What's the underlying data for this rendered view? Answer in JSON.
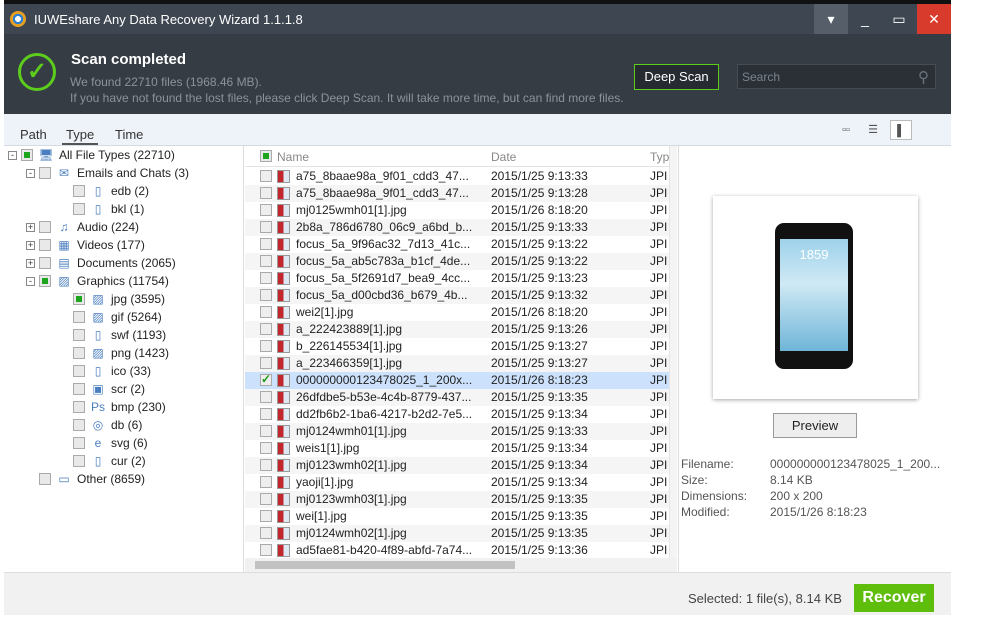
{
  "window": {
    "title": "IUWEshare Any Data Recovery Wizard 1.1.1.8",
    "close_color": "#d83b2b"
  },
  "header": {
    "title": "Scan completed",
    "found": "We found 22710 files (1968.46 MB).",
    "hint": "If you have not found the lost files, please click Deep Scan. It will take more time, but can find more files.",
    "deep_scan": "Deep Scan",
    "search_placeholder": "Search"
  },
  "tabs": [
    {
      "label": "Path"
    },
    {
      "label": "Type",
      "active": true
    },
    {
      "label": "Time"
    }
  ],
  "tree": [
    {
      "label": "All File Types (22710)",
      "level": 0,
      "toggle": "-",
      "checked": true,
      "icon": "monitor-icon"
    },
    {
      "label": "Emails and Chats (3)",
      "level": 1,
      "toggle": "-",
      "icon": "email-icon"
    },
    {
      "label": "edb (2)",
      "level": 2,
      "icon": "file-icon"
    },
    {
      "label": "bkl (1)",
      "level": 2,
      "icon": "file-icon"
    },
    {
      "label": "Audio (224)",
      "level": 1,
      "toggle": "+",
      "icon": "music-icon"
    },
    {
      "label": "Videos (177)",
      "level": 1,
      "toggle": "+",
      "icon": "film-icon"
    },
    {
      "label": "Documents (2065)",
      "level": 1,
      "toggle": "+",
      "icon": "document-icon"
    },
    {
      "label": "Graphics (11754)",
      "level": 1,
      "toggle": "-",
      "checked": true,
      "icon": "picture-icon"
    },
    {
      "label": "jpg (3595)",
      "level": 2,
      "checked": true,
      "icon": "image-icon"
    },
    {
      "label": "gif (5264)",
      "level": 2,
      "icon": "image-icon"
    },
    {
      "label": "swf (1193)",
      "level": 2,
      "icon": "file-icon"
    },
    {
      "label": "png (1423)",
      "level": 2,
      "icon": "image-icon"
    },
    {
      "label": "ico (33)",
      "level": 2,
      "icon": "file-icon"
    },
    {
      "label": "scr (2)",
      "level": 2,
      "icon": "window-icon"
    },
    {
      "label": "bmp (230)",
      "level": 2,
      "icon": "photoshop-icon"
    },
    {
      "label": "db (6)",
      "level": 2,
      "icon": "database-icon"
    },
    {
      "label": "svg (6)",
      "level": 2,
      "icon": "ie-icon"
    },
    {
      "label": "cur (2)",
      "level": 2,
      "icon": "file-icon"
    },
    {
      "label": "Other (8659)",
      "level": 1,
      "icon": "folder-icon"
    }
  ],
  "list": {
    "columns": [
      "Name",
      "Date",
      "Typ"
    ],
    "rows": [
      [
        "a75_8baae98a_9f01_cdd3_47...",
        "2015/1/25 9:13:33",
        "JPI"
      ],
      [
        "a75_8baae98a_9f01_cdd3_47...",
        "2015/1/25 9:13:28",
        "JPI"
      ],
      [
        "mj0125wmh01[1].jpg",
        "2015/1/26 8:18:20",
        "JPI"
      ],
      [
        "2b8a_786d6780_06c9_a6bd_b...",
        "2015/1/25 9:13:33",
        "JPI"
      ],
      [
        "focus_5a_9f96ac32_7d13_41c...",
        "2015/1/25 9:13:22",
        "JPI"
      ],
      [
        "focus_5a_ab5c783a_b1cf_4de...",
        "2015/1/25 9:13:22",
        "JPI"
      ],
      [
        "focus_5a_5f2691d7_bea9_4cc...",
        "2015/1/25 9:13:23",
        "JPI"
      ],
      [
        "focus_5a_d00cbd36_b679_4b...",
        "2015/1/25 9:13:32",
        "JPI"
      ],
      [
        "wei2[1].jpg",
        "2015/1/26 8:18:20",
        "JPI"
      ],
      [
        "a_222423889[1].jpg",
        "2015/1/25 9:13:26",
        "JPI"
      ],
      [
        "b_226145534[1].jpg",
        "2015/1/25 9:13:27",
        "JPI"
      ],
      [
        "a_223466359[1].jpg",
        "2015/1/25 9:13:27",
        "JPI"
      ],
      [
        "000000000123478025_1_200x...",
        "2015/1/26 8:18:23",
        "JPI"
      ],
      [
        "26dfdbe5-b53e-4c4b-8779-437...",
        "2015/1/25 9:13:35",
        "JPI"
      ],
      [
        "dd2fb6b2-1ba6-4217-b2d2-7e5...",
        "2015/1/25 9:13:34",
        "JPI"
      ],
      [
        "mj0124wmh01[1].jpg",
        "2015/1/25 9:13:33",
        "JPI"
      ],
      [
        "weis1[1].jpg",
        "2015/1/25 9:13:34",
        "JPI"
      ],
      [
        "mj0123wmh02[1].jpg",
        "2015/1/25 9:13:34",
        "JPI"
      ],
      [
        "yaoji[1].jpg",
        "2015/1/25 9:13:34",
        "JPI"
      ],
      [
        "mj0123wmh03[1].jpg",
        "2015/1/25 9:13:35",
        "JPI"
      ],
      [
        "wei[1].jpg",
        "2015/1/25 9:13:35",
        "JPI"
      ],
      [
        "mj0124wmh02[1].jpg",
        "2015/1/25 9:13:35",
        "JPI"
      ],
      [
        "ad5fae81-b420-4f89-abfd-7a74...",
        "2015/1/25 9:13:36",
        "JPI"
      ]
    ],
    "selected_index": 12
  },
  "preview": {
    "phone_time": "1859",
    "button": "Preview",
    "meta": [
      [
        "Filename:",
        "000000000123478025_1_200..."
      ],
      [
        "Size:",
        "8.14 KB"
      ],
      [
        "Dimensions:",
        "200 x 200"
      ],
      [
        "Modified:",
        "2015/1/26 8:18:23"
      ]
    ]
  },
  "footer": {
    "selected": "Selected: 1 file(s), 8.14 KB",
    "recover": "Recover",
    "accent": "#5fbd0c"
  }
}
